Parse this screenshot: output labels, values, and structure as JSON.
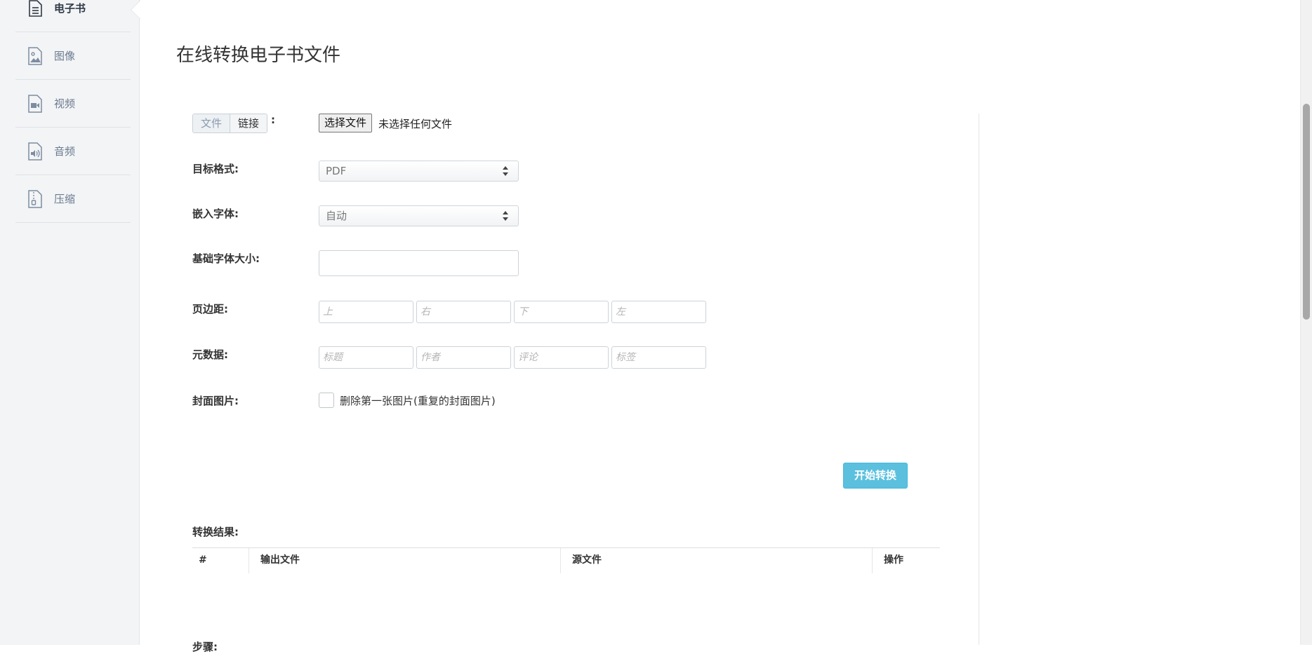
{
  "sidebar": {
    "items": [
      {
        "label": "电子书",
        "icon": "document-icon",
        "active": true
      },
      {
        "label": "图像",
        "icon": "image-icon",
        "active": false
      },
      {
        "label": "视频",
        "icon": "video-icon",
        "active": false
      },
      {
        "label": "音频",
        "icon": "audio-icon",
        "active": false
      },
      {
        "label": "压缩",
        "icon": "zip-icon",
        "active": false
      }
    ]
  },
  "page": {
    "title": "在线转换电子书文件"
  },
  "source": {
    "tab_file": "文件",
    "tab_link": "链接",
    "colon": ":",
    "choose_file_label": "选择文件",
    "no_file_text": "未选择任何文件"
  },
  "form": {
    "target_format_label": "目标格式:",
    "target_format_value": "PDF",
    "embed_font_label": "嵌入字体:",
    "embed_font_value": "自动",
    "base_font_size_label": "基础字体大小:",
    "base_font_size_value": "",
    "margin_label": "页边距:",
    "margin_placeholders": {
      "top": "上",
      "right": "右",
      "bottom": "下",
      "left": "左"
    },
    "metadata_label": "元数据:",
    "metadata_placeholders": {
      "title": "标题",
      "author": "作者",
      "comment": "评论",
      "tags": "标签"
    },
    "cover_label": "封面图片:",
    "cover_checkbox_label": "删除第一张图片(重复的封面图片)",
    "cover_checkbox_checked": false
  },
  "actions": {
    "convert_label": "开始转换"
  },
  "results": {
    "label": "转换结果:",
    "columns": [
      "#",
      "输出文件",
      "源文件",
      "操作"
    ]
  },
  "steps": {
    "label": "步骤:"
  },
  "colors": {
    "accent": "#5bc0de",
    "sidebar_bg": "#f3f4f6",
    "sidebar_text": "#6a7a8e"
  }
}
